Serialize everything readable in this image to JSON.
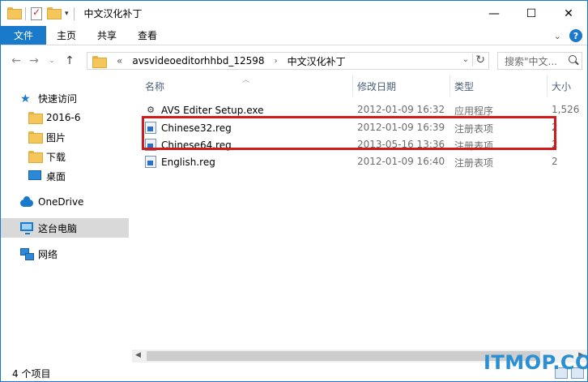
{
  "window": {
    "title": "中文汉化补丁"
  },
  "ribbon": {
    "tabs": [
      "文件",
      "主页",
      "共享",
      "查看"
    ]
  },
  "address": {
    "overflow": "«",
    "crumbs": [
      "avsvideoeditorhhbd_12598",
      "中文汉化补丁"
    ]
  },
  "search": {
    "placeholder": "搜索\"中文..."
  },
  "nav": {
    "items": [
      {
        "label": "快速访问",
        "icon": "star-icon"
      },
      {
        "label": "2016-6",
        "icon": "folder-icon"
      },
      {
        "label": "图片",
        "icon": "folder-icon"
      },
      {
        "label": "下载",
        "icon": "folder-icon"
      },
      {
        "label": "桌面",
        "icon": "desktop-icon"
      },
      {
        "label": "OneDrive",
        "icon": "cloud-icon"
      },
      {
        "label": "这台电脑",
        "icon": "computer-icon"
      },
      {
        "label": "网络",
        "icon": "network-icon"
      }
    ]
  },
  "columns": [
    "名称",
    "修改日期",
    "类型",
    "大小"
  ],
  "files": [
    {
      "name": "AVS Editer Setup.exe",
      "date": "2012-01-09 16:32",
      "type": "应用程序",
      "size": "1,526",
      "icon": "exe-icon"
    },
    {
      "name": "Chinese32.reg",
      "date": "2012-01-09 16:39",
      "type": "注册表项",
      "size": "2",
      "icon": "reg-icon"
    },
    {
      "name": "Chinese64.reg",
      "date": "2013-05-16 13:36",
      "type": "注册表项",
      "size": "2",
      "icon": "reg-icon"
    },
    {
      "name": "English.reg",
      "date": "2012-01-09 16:40",
      "type": "注册表项",
      "size": "2",
      "icon": "reg-icon"
    }
  ],
  "status": {
    "count": "4 个项目"
  },
  "watermark": "ITMOP.COM",
  "colors": {
    "accent": "#1979ca",
    "highlight": "#d11a1a"
  }
}
